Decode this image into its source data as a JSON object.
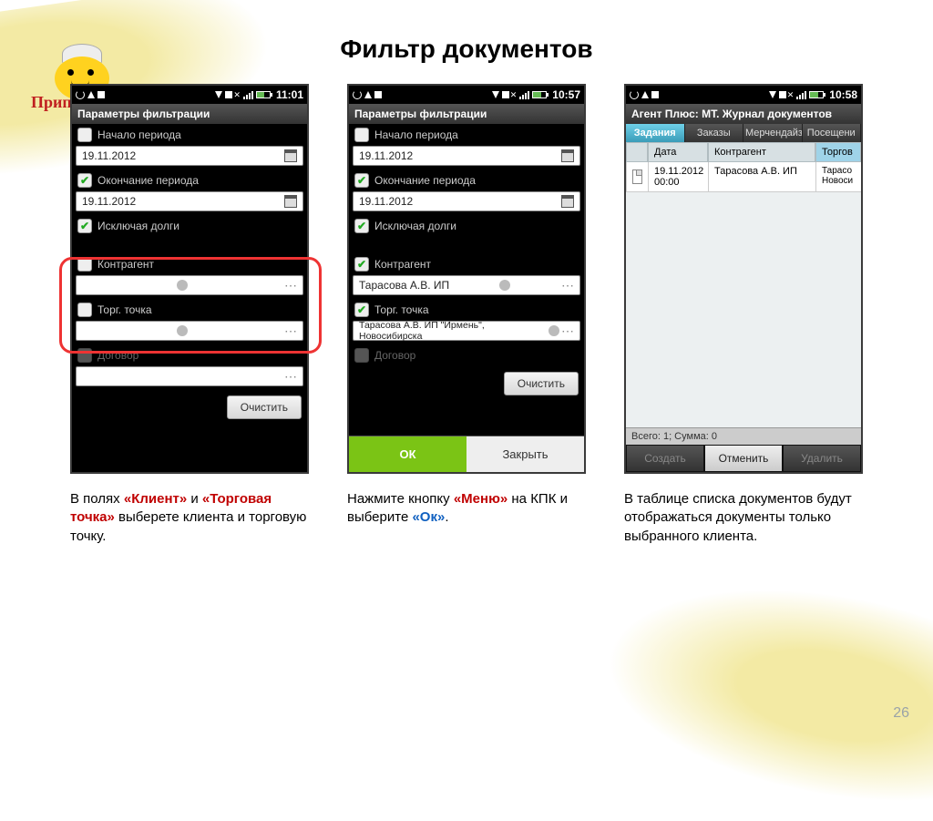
{
  "page_number": "26",
  "logo_text": "Приправыч",
  "title": "Фильтр документов",
  "statusbar": {
    "time1": "11:01",
    "time2": "10:57",
    "time3": "10:58"
  },
  "phone1": {
    "header": "Параметры фильтрации",
    "start_period_label": "Начало периода",
    "start_period_value": "19.11.2012",
    "end_period_label": "Окончание периода",
    "end_period_value": "19.11.2012",
    "exclude_debts_label": "Исключая долги",
    "kontragent_label": "Контрагент",
    "kontragent_value": "",
    "torg_label": "Торг. точка",
    "torg_value": "",
    "dogovor_label": "Договор",
    "dogovor_value": "",
    "clear_btn": "Очистить"
  },
  "phone2": {
    "header": "Параметры фильтрации",
    "start_period_label": "Начало периода",
    "start_period_value": "19.11.2012",
    "end_period_label": "Окончание периода",
    "end_period_value": "19.11.2012",
    "exclude_debts_label": "Исключая долги",
    "kontragent_label": "Контрагент",
    "kontragent_value": "Тарасова А.В. ИП",
    "torg_label": "Торг. точка",
    "torg_value": "Тарасова А.В. ИП \"Ирмень\", Новосибирска",
    "dogovor_label": "Договор",
    "clear_btn": "Очистить",
    "ok_btn": "ОК",
    "close_btn": "Закрыть"
  },
  "phone3": {
    "header": "Агент Плюс: МТ. Журнал документов",
    "tabs": [
      "Задания",
      "Заказы",
      "Мерчендайзинг",
      "Посещени"
    ],
    "col_date": "Дата",
    "col_contr": "Контрагент",
    "col_torg": "Торгов",
    "row_date": "19.11.2012 00:00",
    "row_contr": "Тарасова А.В. ИП",
    "row_torg": "Тарасо Новоси",
    "footer_info": "Всего: 1; Сумма: 0",
    "btn_create": "Создать",
    "btn_cancel": "Отменить",
    "btn_delete": "Удалить"
  },
  "caption1": {
    "pre": "В полях ",
    "b1": "«Клиент»",
    "mid": " и ",
    "b2": "«Торговая точка»",
    "post": " выберете клиента и торговую точку."
  },
  "caption2": {
    "pre": "Нажмите кнопку ",
    "b1": "«Меню»",
    "mid": " на КПК и выберите ",
    "b2": "«Ок»",
    "post": "."
  },
  "caption3": {
    "text": "В таблице списка документов будут отображаться документы только выбранного клиента."
  }
}
